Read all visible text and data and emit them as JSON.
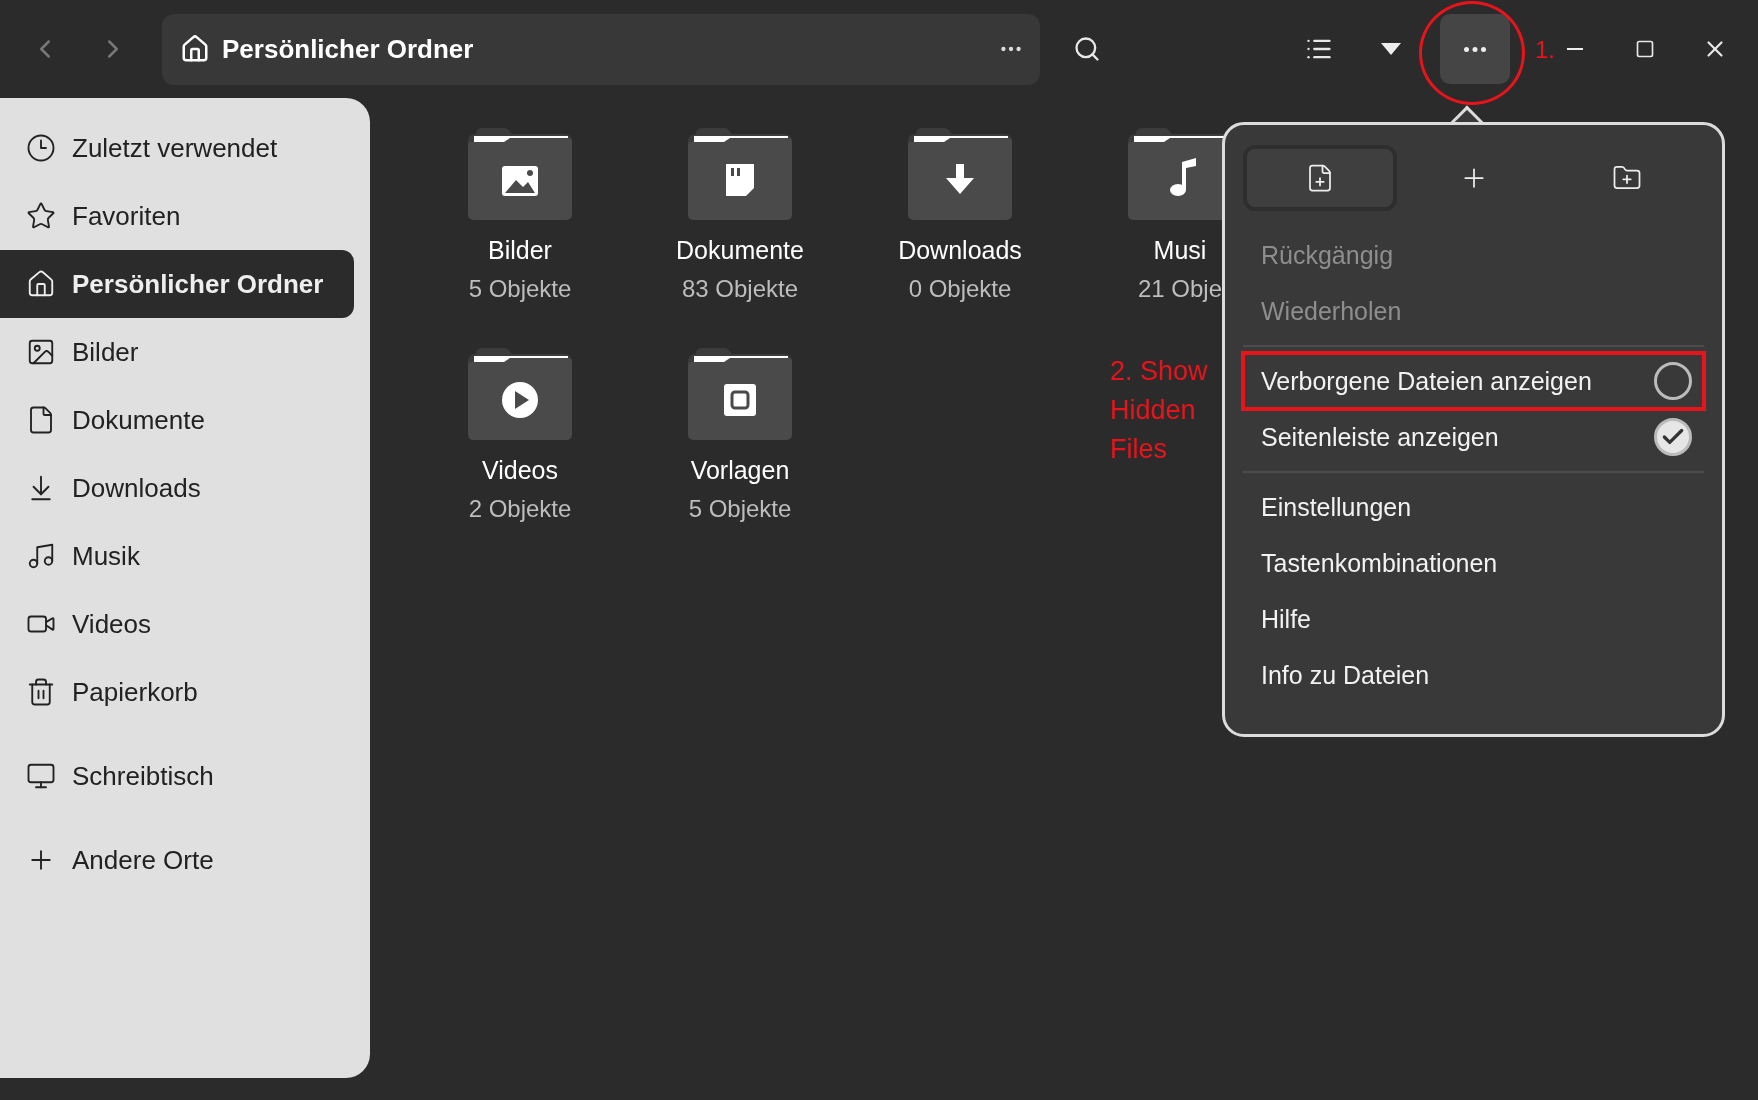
{
  "header": {
    "path_title": "Persönlicher Ordner",
    "more_button": {
      "selected": true,
      "circled": true
    },
    "annotation": "1."
  },
  "sidebar": {
    "sections": [
      {
        "items": [
          {
            "label": "Zuletzt verwendet",
            "selected": false
          },
          {
            "label": "Favoriten",
            "selected": false
          },
          {
            "label": "Persönlicher Ordner",
            "selected": true
          },
          {
            "label": "Bilder",
            "selected": false
          },
          {
            "label": "Dokumente",
            "selected": false
          },
          {
            "label": "Downloads",
            "selected": false
          },
          {
            "label": "Musik",
            "selected": false
          },
          {
            "label": "Videos",
            "selected": false
          },
          {
            "label": "Papierkorb",
            "selected": false
          }
        ]
      },
      {
        "items": [
          {
            "label": "Schreibtisch",
            "selected": false
          }
        ]
      },
      {
        "items": [
          {
            "label": "Andere Orte",
            "selected": false
          }
        ]
      }
    ]
  },
  "folders": [
    {
      "name": "Bilder",
      "count": "5 Objekte"
    },
    {
      "name": "Dokumente",
      "count": "83 Objekte"
    },
    {
      "name": "Downloads",
      "count": "0 Objekte"
    },
    {
      "name": "Musi",
      "count": "21 Obje"
    },
    {
      "name": "Videos",
      "count": "2 Objekte"
    },
    {
      "name": "Vorlagen",
      "count": "5 Objekte"
    }
  ],
  "annotation_note": "2. Show Hidden Files",
  "menu": {
    "tools": [
      {
        "selected": true
      },
      {
        "selected": false
      },
      {
        "selected": false
      }
    ],
    "groups": [
      {
        "items": [
          {
            "kind": "action",
            "label": "Rückgängig",
            "disabled": true
          },
          {
            "kind": "action",
            "label": "Wiederholen",
            "disabled": true
          }
        ]
      },
      {
        "items": [
          {
            "kind": "toggle",
            "label": "Verborgene Dateien anzeigen",
            "checked": false,
            "highlighted": true
          },
          {
            "kind": "toggle",
            "label": "Seitenleiste anzeigen",
            "checked": true,
            "highlighted": false
          }
        ]
      },
      {
        "items": [
          {
            "kind": "action",
            "label": "Einstellungen",
            "disabled": false
          },
          {
            "kind": "action",
            "label": "Tastenkombinationen",
            "disabled": false
          },
          {
            "kind": "action",
            "label": "Hilfe",
            "disabled": false
          },
          {
            "kind": "action",
            "label": "Info zu Dateien",
            "disabled": false
          }
        ]
      }
    ]
  }
}
